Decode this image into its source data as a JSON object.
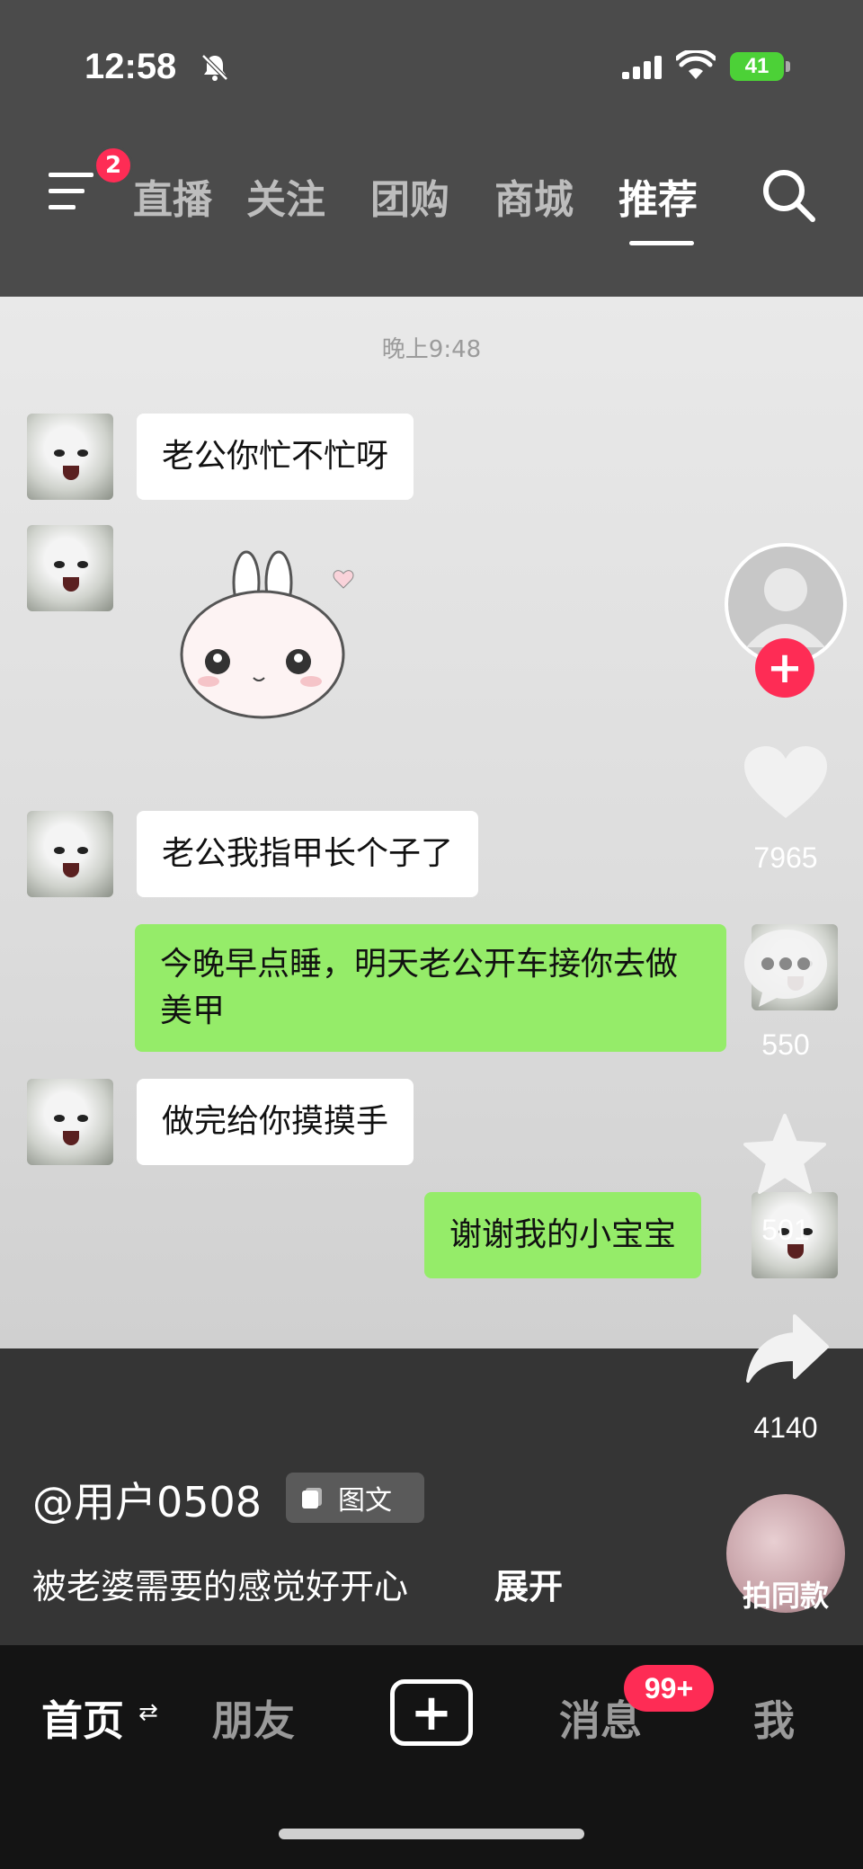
{
  "status": {
    "time": "12:58",
    "battery": "41"
  },
  "nav": {
    "menu_badge": "2",
    "tabs": [
      "直播",
      "关注",
      "团购",
      "商城",
      "推荐"
    ]
  },
  "chat": {
    "time": "晚上9:48",
    "messages": [
      "老公你忙不忙呀",
      "老公我指甲长个子了",
      "今晚早点睡，明天老公开车接你去做美甲",
      "做完给你摸摸手",
      "谢谢我的小宝宝"
    ]
  },
  "rail": {
    "likes": "7965",
    "comments": "550",
    "favorites": "501",
    "shares": "4140",
    "sound_label": "拍同款"
  },
  "post": {
    "username": "@用户0508",
    "tag": "图文",
    "description": "被老婆需要的感觉好开心",
    "more": "展开"
  },
  "bottom_nav": {
    "home": "首页",
    "friends": "朋友",
    "create": "+",
    "messages": "消息",
    "messages_badge": "99+",
    "me": "我"
  },
  "colors": {
    "accent": "#fe2c55",
    "green_bubble": "#95ec69",
    "battery": "#4cd137"
  }
}
